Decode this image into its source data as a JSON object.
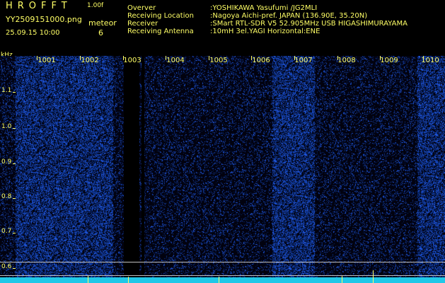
{
  "app": {
    "title": "HROFFT",
    "version": "1.00f",
    "file_name": "YY2509151000.png",
    "timestamp": "25.09.15 10:00",
    "meteor_label": "meteor",
    "meteor_count": "6"
  },
  "info": [
    {
      "label": "Overver",
      "value": ":YOSHIKAWA Yasufumi /JG2MLI"
    },
    {
      "label": "Receiving Location",
      "value": ":Nagoya Aichi-pref. JAPAN (136.90E, 35.20N)"
    },
    {
      "label": "Receiver",
      "value": ":SMart RTL-SDR V5 52.905MHz USB HIGASHIMURAYAMA"
    },
    {
      "label": "Receiving Antenna",
      "value": ":10mH 3el.YAGI Horizontal:ENE"
    }
  ],
  "axis": {
    "unit": "kHz",
    "x_ticks": [
      "1001",
      "1002",
      "1003",
      "1004",
      "1005",
      "1006",
      "1007",
      "1008",
      "1009",
      "1010"
    ],
    "y_ticks": [
      "1.1",
      "1.0",
      "0.9",
      "0.8",
      "0.7",
      "0.6"
    ]
  },
  "colors": {
    "text": "#ffff66",
    "noise": "#2a3cff",
    "baseline": "#1fc8e8",
    "background": "#000000"
  }
}
